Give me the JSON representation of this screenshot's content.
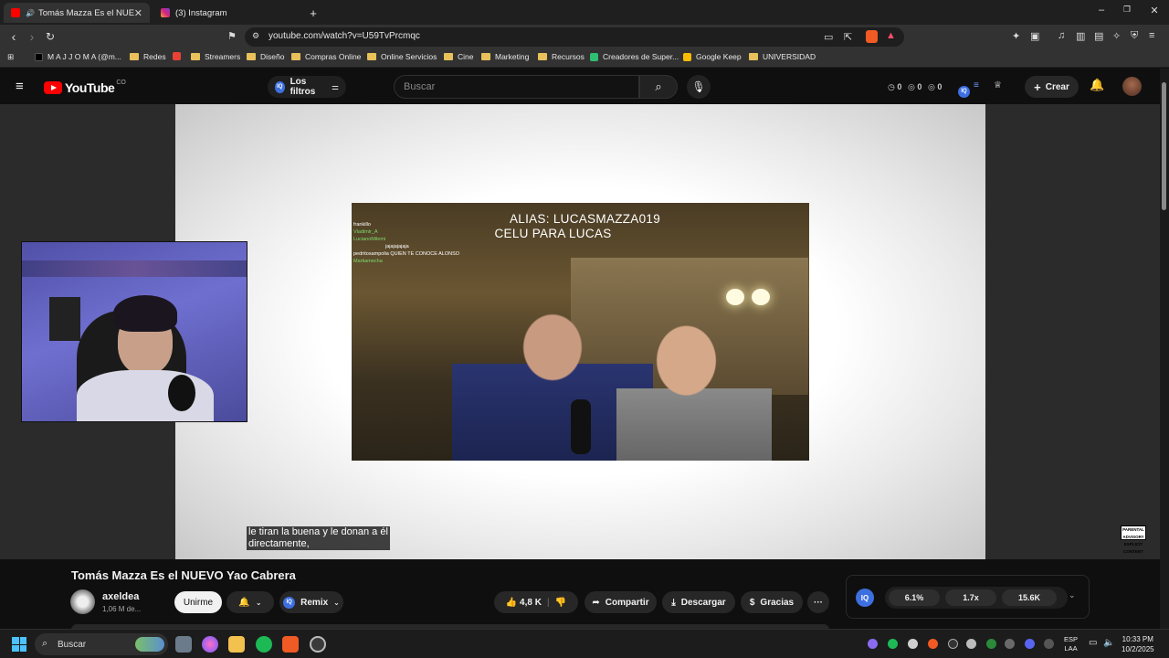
{
  "browser": {
    "tabs": [
      {
        "title": "Tomás Mazza Es el NUEVO Yao",
        "active": true,
        "icon": "youtube-icon"
      },
      {
        "title": "(3) Instagram",
        "active": false,
        "icon": "instagram-icon"
      }
    ],
    "new_tab": "+",
    "url": "youtube.com/watch?v=U59TvPrcmqc",
    "window_controls": {
      "minimize": "–",
      "restore": "❐",
      "close": "✕"
    }
  },
  "bookmarks": [
    {
      "label": "M A J J O M A (@m...",
      "type": "site"
    },
    {
      "label": "Redes",
      "type": "folder"
    },
    {
      "label": "Streamers",
      "type": "folder"
    },
    {
      "label": "Diseño",
      "type": "folder"
    },
    {
      "label": "Compras Online",
      "type": "folder"
    },
    {
      "label": "Online Servicios",
      "type": "folder"
    },
    {
      "label": "Cine",
      "type": "folder"
    },
    {
      "label": "Marketing",
      "type": "folder"
    },
    {
      "label": "Recursos",
      "type": "folder"
    },
    {
      "label": "Creadores de Super...",
      "type": "site"
    },
    {
      "label": "Google Keep",
      "type": "site"
    },
    {
      "label": "UNIVERSIDAD",
      "type": "folder"
    }
  ],
  "youtube": {
    "logo_text": "YouTube",
    "country": "CO",
    "filters_label": "Los filtros",
    "iq_badge": "IQ",
    "search_placeholder": "Buscar",
    "stats": [
      "0",
      "0",
      "0"
    ],
    "create_label": "Crear"
  },
  "video": {
    "stream_title_line1": "ALIAS: LUCASMAZZA019",
    "stream_title_line2": "CELU PARA LUCAS",
    "chat": [
      {
        "user": "",
        "text": "frankillo"
      },
      {
        "user": "Vladimir_A",
        "text": ""
      },
      {
        "user": "LucianoMilemi",
        "text": ""
      },
      {
        "user": "",
        "text": "jajajajajaja"
      },
      {
        "user": "",
        "text": "pedritosampolia QUIEN TE CONOCE ALONSO"
      },
      {
        "user": "Martiamecha",
        "text": ""
      }
    ],
    "caption_line1": "le tiran la buena y le donan a él",
    "caption_line2": "directamente,",
    "advisory": "PARENTAL ADVISORY EXPLICIT CONTENT"
  },
  "info": {
    "title": "Tomás Mazza Es el NUEVO Yao Cabrera",
    "channel": "axeldea",
    "subscribers": "1,06 M de...",
    "join": "Unirme",
    "remix": "Remix",
    "likes": "4,8 K",
    "share": "Compartir",
    "download": "Descargar",
    "thanks": "Gracias",
    "more": "···"
  },
  "iq_panel": {
    "values": [
      "6.1%",
      "1.7x",
      "15.6K"
    ]
  },
  "taskbar": {
    "search": "Buscar",
    "lang_line1": "ESP",
    "lang_line2": "LAA",
    "time": "10:33 PM",
    "date": "10/2/2025"
  }
}
